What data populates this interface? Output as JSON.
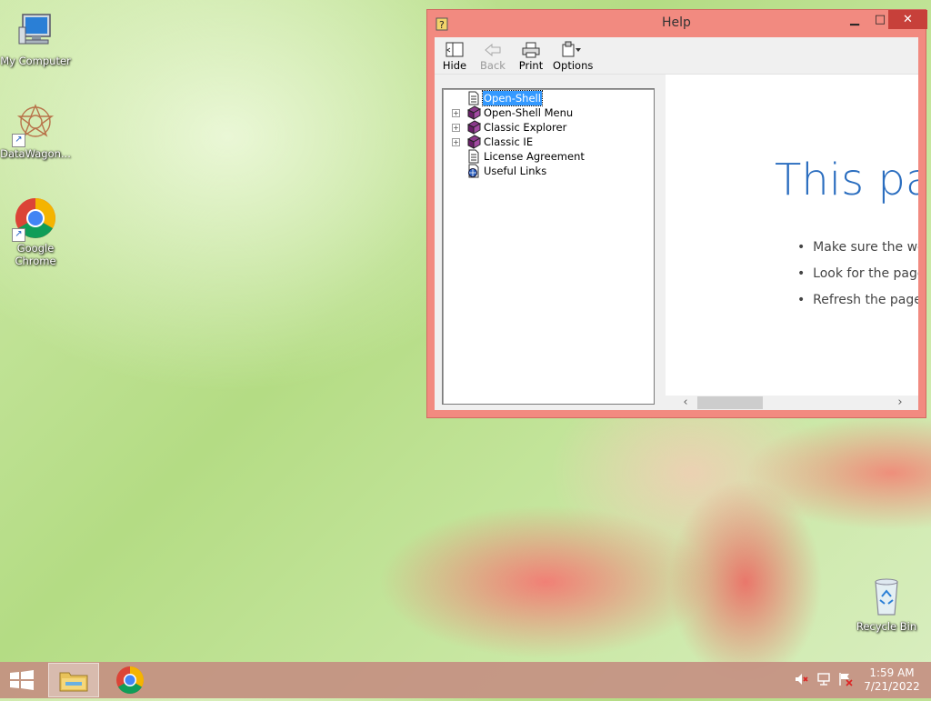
{
  "desktop": {
    "icons": [
      {
        "label": "My Computer"
      },
      {
        "label": "DataWagon..."
      },
      {
        "label": "Google Chrome"
      },
      {
        "label": "Recycle Bin"
      }
    ]
  },
  "help_window": {
    "title": "Help",
    "toolbar": {
      "hide": "Hide",
      "back": "Back",
      "print": "Print",
      "options": "Options"
    },
    "tree": [
      {
        "label": "Open-Shell",
        "icon": "page-icon",
        "expandable": false,
        "selected": true
      },
      {
        "label": "Open-Shell Menu",
        "icon": "book-icon",
        "expandable": true
      },
      {
        "label": "Classic Explorer",
        "icon": "book-icon",
        "expandable": true
      },
      {
        "label": "Classic IE",
        "icon": "book-icon",
        "expandable": true
      },
      {
        "label": "License Agreement",
        "icon": "page-icon",
        "expandable": false
      },
      {
        "label": "Useful Links",
        "icon": "web-page-icon",
        "expandable": false
      }
    ],
    "content": {
      "heading": "This pag",
      "bullets": [
        "Make sure the wel",
        "Look for the page",
        "Refresh the page i"
      ]
    }
  },
  "taskbar": {
    "clock_time": "1:59 AM",
    "clock_date": "7/21/2022"
  },
  "colors": {
    "window_frame": "#f28a80",
    "close_button": "#c7403a",
    "heading_blue": "#2a6dbf",
    "selection": "#3399ff"
  }
}
